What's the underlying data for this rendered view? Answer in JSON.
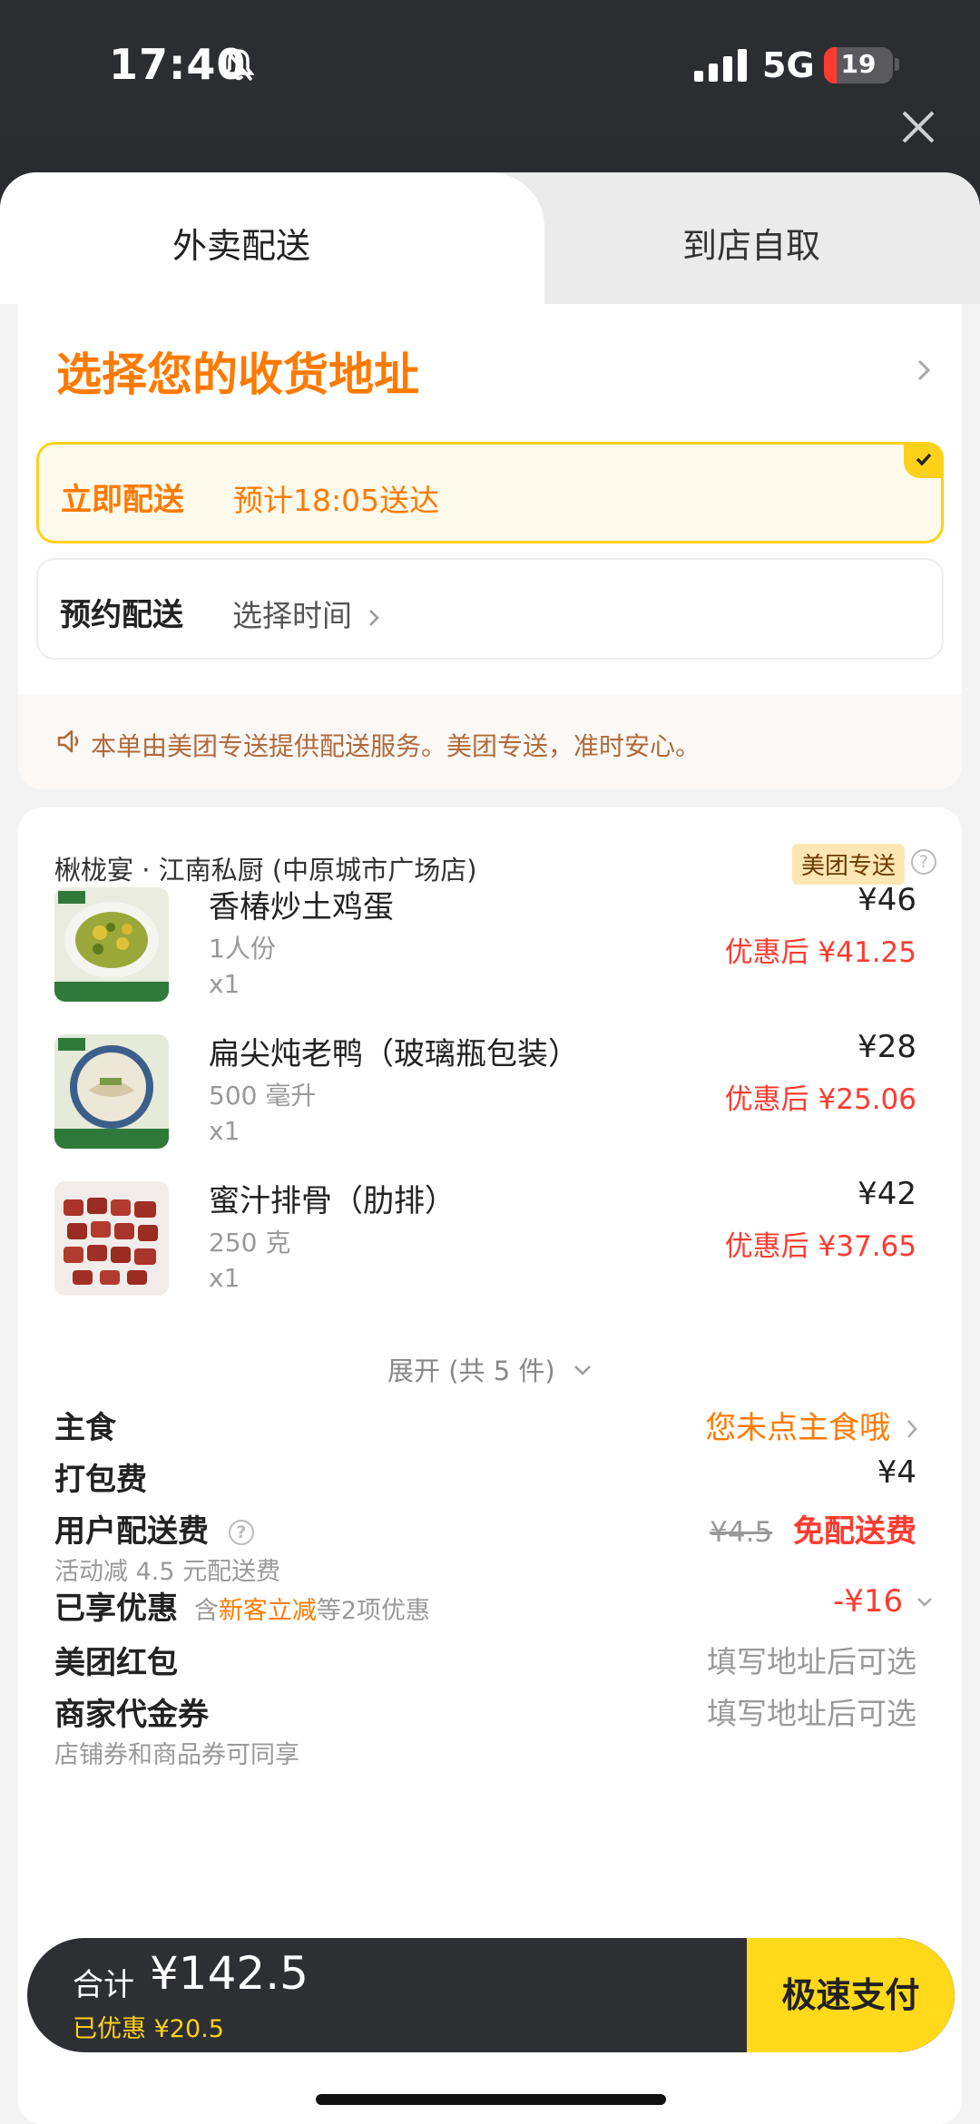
{
  "status_bar": {
    "time": "17:40",
    "network": "5G",
    "battery": "19",
    "battery_level": 0.19
  },
  "tabs": [
    {
      "label": "外卖配送"
    },
    {
      "label": "到店自取"
    }
  ],
  "address": {
    "title": "选择您的收货地址"
  },
  "delivery_options": {
    "instant": {
      "label": "立即配送",
      "value": "预计18:05送达"
    },
    "scheduled": {
      "label": "预约配送",
      "value": "选择时间"
    }
  },
  "notice": "本单由美团专送提供配送服务。美团专送，准时安心。",
  "order": {
    "shop_name": "楸栊宴 · 江南私厨 (中原城市广场店)",
    "delivery_badge": "美团专送",
    "items": [
      {
        "name": "香椿炒土鸡蛋",
        "spec": "1人份",
        "qty": "x1",
        "price": "¥46",
        "discount": "优惠后 ¥41.25"
      },
      {
        "name": "扁尖炖老鸭（玻璃瓶包装）",
        "spec": "500 毫升",
        "qty": "x1",
        "price": "¥28",
        "discount": "优惠后 ¥25.06"
      },
      {
        "name": "蜜汁排骨（肋排）",
        "spec": "250 克",
        "qty": "x1",
        "price": "¥42",
        "discount": "优惠后 ¥37.65"
      }
    ],
    "expand": "展开 (共 5 件)",
    "staple": {
      "label": "主食",
      "value": "您未点主食哦"
    },
    "packing_fee": {
      "label": "打包费",
      "value": "¥4"
    },
    "delivery_fee": {
      "label": "用户配送费",
      "sub": "活动减 4.5 元配送费",
      "original": "¥4.5",
      "value": "免配送费"
    },
    "discounts": {
      "label": "已享优惠",
      "desc_prefix": "含",
      "desc_highlight": "新客立减",
      "desc_suffix": "等2项优惠",
      "value": "-¥16"
    },
    "red_packet": {
      "label": "美团红包",
      "value": "填写地址后可选"
    },
    "voucher": {
      "label": "商家代金券",
      "sub": "店铺券和商品券可同享",
      "value": "填写地址后可选"
    }
  },
  "pay_bar": {
    "total_label": "合计",
    "total": "¥142.5",
    "saved": "已优惠 ¥20.5",
    "button": "极速支付"
  },
  "colors": {
    "accent": "#ff7a00",
    "price_red": "#ff3b30",
    "pay_button": "#ffd91a",
    "highlight_border": "#ffd11a"
  }
}
